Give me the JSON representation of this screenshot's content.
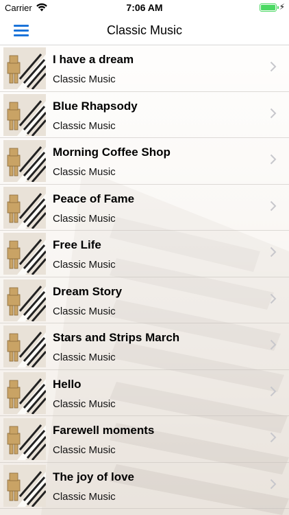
{
  "status_bar": {
    "carrier": "Carrier",
    "time": "7:06 AM"
  },
  "nav": {
    "title": "Classic Music",
    "menu_icon": "hamburger-menu-icon"
  },
  "tracks": [
    {
      "title": "I have a dream",
      "subtitle": "Classic Music"
    },
    {
      "title": "Blue Rhapsody",
      "subtitle": "Classic Music"
    },
    {
      "title": "Morning Coffee Shop",
      "subtitle": "Classic Music"
    },
    {
      "title": "Peace of Fame",
      "subtitle": "Classic Music"
    },
    {
      "title": "Free Life",
      "subtitle": "Classic Music"
    },
    {
      "title": "Dream Story",
      "subtitle": "Classic Music"
    },
    {
      "title": "Stars and Strips March",
      "subtitle": "Classic Music"
    },
    {
      "title": "Hello",
      "subtitle": "Classic Music"
    },
    {
      "title": "Farewell moments",
      "subtitle": "Classic Music"
    },
    {
      "title": "The joy of love",
      "subtitle": "Classic Music"
    }
  ],
  "colors": {
    "accent": "#1a73d9",
    "battery": "#4cd964"
  }
}
